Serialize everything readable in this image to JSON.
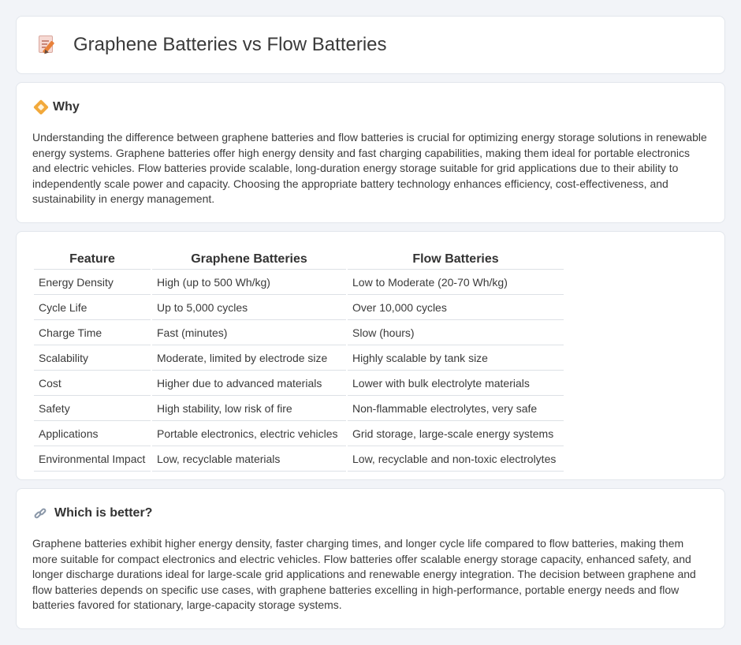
{
  "header": {
    "title": "Graphene Batteries vs Flow Batteries",
    "icon": "document-edit-icon"
  },
  "why": {
    "heading": "Why",
    "icon": "diamond-warning-icon",
    "text": "Understanding the difference between graphene batteries and flow batteries is crucial for optimizing energy storage solutions in renewable energy systems. Graphene batteries offer high energy density and fast charging capabilities, making them ideal for portable electronics and electric vehicles. Flow batteries provide scalable, long-duration energy storage suitable for grid applications due to their ability to independently scale power and capacity. Choosing the appropriate battery technology enhances efficiency, cost-effectiveness, and sustainability in energy management."
  },
  "table": {
    "headers": [
      "Feature",
      "Graphene Batteries",
      "Flow Batteries"
    ],
    "rows": [
      [
        "Energy Density",
        "High (up to 500 Wh/kg)",
        "Low to Moderate (20-70 Wh/kg)"
      ],
      [
        "Cycle Life",
        "Up to 5,000 cycles",
        "Over 10,000 cycles"
      ],
      [
        "Charge Time",
        "Fast (minutes)",
        "Slow (hours)"
      ],
      [
        "Scalability",
        "Moderate, limited by electrode size",
        "Highly scalable by tank size"
      ],
      [
        "Cost",
        "Higher due to advanced materials",
        "Lower with bulk electrolyte materials"
      ],
      [
        "Safety",
        "High stability, low risk of fire",
        "Non-flammable electrolytes, very safe"
      ],
      [
        "Applications",
        "Portable electronics, electric vehicles",
        "Grid storage, large-scale energy systems"
      ],
      [
        "Environmental Impact",
        "Low, recyclable materials",
        "Low, recyclable and non-toxic electrolytes"
      ]
    ]
  },
  "better": {
    "heading": "Which is better?",
    "icon": "link-icon",
    "text": "Graphene batteries exhibit higher energy density, faster charging times, and longer cycle life compared to flow batteries, making them more suitable for compact electronics and electric vehicles. Flow batteries offer scalable energy storage capacity, enhanced safety, and longer discharge durations ideal for large-scale grid applications and renewable energy integration. The decision between graphene and flow batteries depends on specific use cases, with graphene batteries excelling in high-performance, portable energy needs and flow batteries favored for stationary, large-capacity storage systems."
  }
}
